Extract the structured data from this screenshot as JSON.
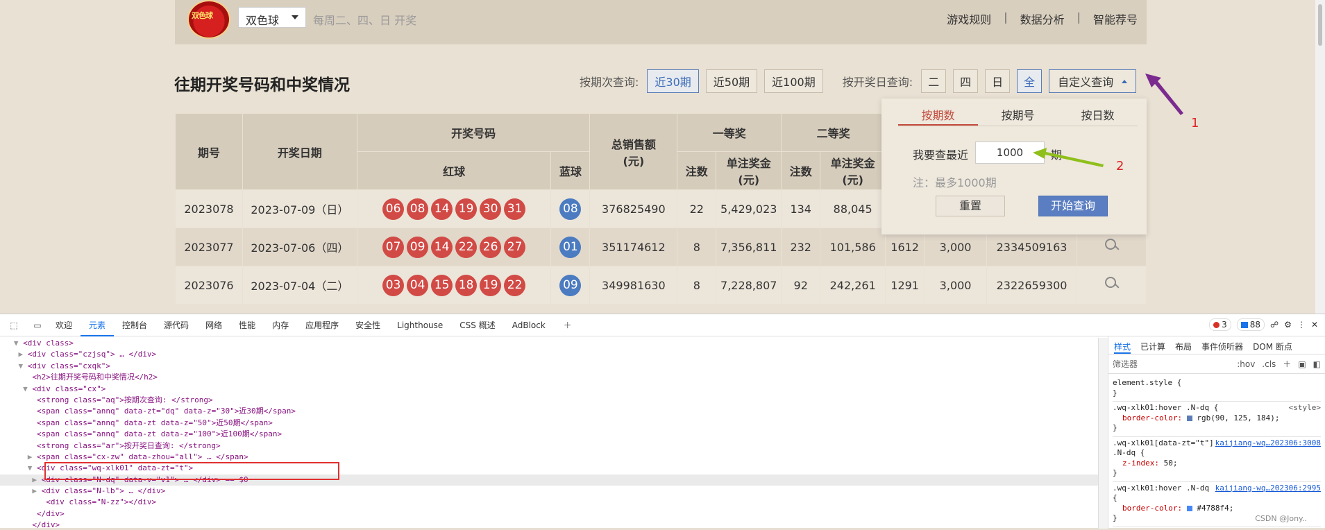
{
  "header": {
    "logo_text": "双色球",
    "lottery_select": "双色球",
    "schedule": "每周二、四、日 开奖",
    "nav": [
      "游戏规则",
      "数据分析",
      "智能荐号"
    ],
    "sep": "|"
  },
  "page_title": "往期开奖号码和中奖情况",
  "query": {
    "by_period_label": "按期次查询:",
    "period_buttons": [
      "近30期",
      "近50期",
      "近100期"
    ],
    "by_day_label": "按开奖日查询:",
    "day_buttons": [
      "二",
      "四",
      "日",
      "全"
    ],
    "custom_label": "自定义查询"
  },
  "table": {
    "headers": {
      "issue": "期号",
      "date": "开奖日期",
      "numbers": "开奖号码",
      "red": "红球",
      "blue": "蓝球",
      "sales": "总销售额\n(元)",
      "first": "一等奖",
      "second": "二等奖",
      "count": "注数",
      "prize": "单注奖金\n(元)"
    },
    "rows": [
      {
        "issue": "2023078",
        "date": "2023-07-09（日）",
        "red": [
          "06",
          "08",
          "14",
          "19",
          "30",
          "31"
        ],
        "blue": "08",
        "sales": "376825490",
        "first_count": "22",
        "first_prize": "5,429,023",
        "second_count": "134",
        "second_prize": "88,045",
        "third_count": "",
        "third_prize": "",
        "pool": ""
      },
      {
        "issue": "2023077",
        "date": "2023-07-06（四）",
        "red": [
          "07",
          "09",
          "14",
          "22",
          "26",
          "27"
        ],
        "blue": "01",
        "sales": "351174612",
        "first_count": "8",
        "first_prize": "7,356,811",
        "second_count": "232",
        "second_prize": "101,586",
        "third_count": "1612",
        "third_prize": "3,000",
        "pool": "2334509163"
      },
      {
        "issue": "2023076",
        "date": "2023-07-04（二）",
        "red": [
          "03",
          "04",
          "15",
          "18",
          "19",
          "22"
        ],
        "blue": "09",
        "sales": "349981630",
        "first_count": "8",
        "first_prize": "7,228,807",
        "second_count": "92",
        "second_prize": "242,261",
        "third_count": "1291",
        "third_prize": "3,000",
        "pool": "2322659300"
      }
    ]
  },
  "panel": {
    "tabs": [
      "按期数",
      "按期号",
      "按日数"
    ],
    "label": "我要查最近",
    "input_value": "1000",
    "unit": "期",
    "note": "注：最多1000期",
    "reset": "重置",
    "start": "开始查询"
  },
  "annotations": [
    "1",
    "2"
  ],
  "devtools": {
    "tabs": [
      "欢迎",
      "元素",
      "控制台",
      "源代码",
      "网络",
      "性能",
      "内存",
      "应用程序",
      "安全性",
      "Lighthouse",
      "CSS 概述",
      "AdBlock"
    ],
    "active_tab": "元素",
    "errors": "3",
    "messages": "88",
    "styles_tabs": [
      "样式",
      "已计算",
      "布局",
      "事件侦听器",
      "DOM 断点"
    ],
    "filter_placeholder": "筛选器",
    "filter_hov": ":hov",
    "filter_cls": ".cls",
    "watermark": "CSDN @Jony.."
  },
  "dom_lines": [
    "<div class>",
    "<div class=\"czjsq\"> … </div>",
    "<div class=\"cxqk\">",
    "<h2>往期开奖号码和中奖情况</h2>",
    "<div class=\"cx\">",
    "<strong class=\"aq\">按期次查询: </strong>",
    "<span class=\"annq\" data-zt=\"dq\" data-z=\"30\">近30期</span>",
    "<span class=\"annq\" data-zt data-z=\"50\">近50期</span>",
    "<span class=\"annq\" data-zt data-z=\"100\">近100期</span>",
    "<strong class=\"ar\">按开奖日查询: </strong>",
    "<span class=\"cx-zw\" data-zhou=\"all\"> … </span>",
    "<div class=\"wq-xlk01\" data-zt=\"t\">",
    "<div class=\"N-dq\" data-v=\"v1\"> … </div> == $0",
    "<div class=\"N-lb\"> … </div>",
    "<div class=\"N-zz\"></div>",
    "</div>",
    "</div>"
  ],
  "styles_rules": [
    {
      "selector": "element.style {",
      "source": "",
      "props": []
    },
    {
      "selector": ".wq-xlk01:hover .N-dq {",
      "source": "<style>",
      "props": [
        {
          "name": "border-color:",
          "value": "rgb(90, 125, 184);",
          "swatch": "#5a7db8"
        }
      ]
    },
    {
      "selector": ".wq-xlk01[data-zt=\"t\"] .N-dq {",
      "source": "kaijiang-wq…202306:3008",
      "props": [
        {
          "name": "z-index:",
          "value": "50;",
          "swatch": ""
        }
      ]
    },
    {
      "selector": ".wq-xlk01:hover .N-dq {",
      "source": "kaijiang-wq…202306:2995",
      "props": [
        {
          "name": "border-color:",
          "value": "#4788f4;",
          "swatch": "#4788f4"
        }
      ]
    }
  ]
}
